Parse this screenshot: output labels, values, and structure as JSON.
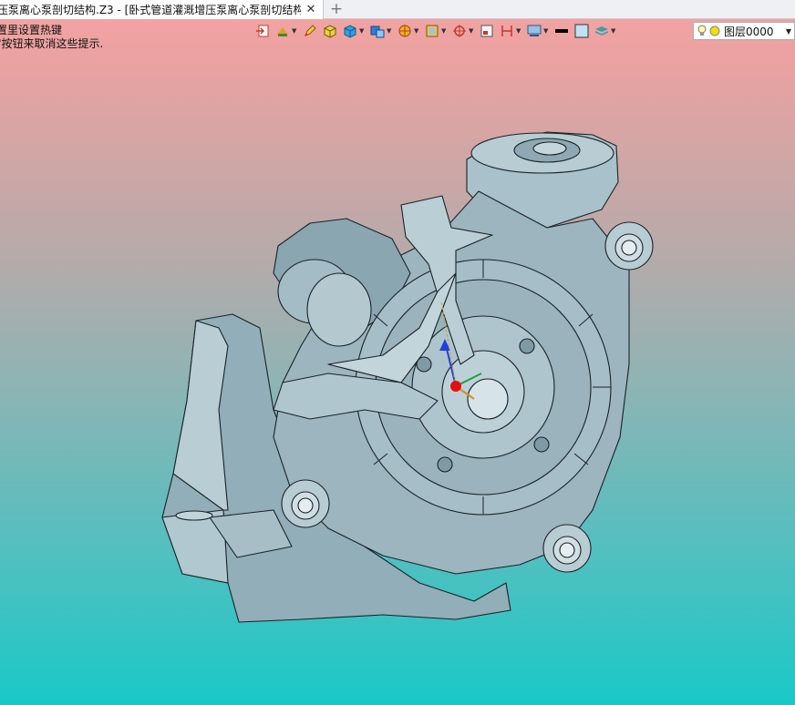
{
  "tabbar": {
    "tab_title": "压泵离心泵剖切结构.Z3 - [卧式管道灌溉增压泵离心泵剖切结构]",
    "close_icon": "close-icon",
    "add_icon": "plus-icon"
  },
  "hint": {
    "line1": "置里设置热键",
    "line2": "\"按钮来取消这些提示."
  },
  "toolbar": {
    "icons": [
      "exit-icon",
      "tree-icon",
      "pen-icon",
      "box-icon",
      "cube-icon",
      "view-cube-icon",
      "render-icon",
      "display-icon",
      "axis-icon",
      "frame-icon",
      "dimension-icon",
      "filter-icon",
      "line-color-icon",
      "fill-color-icon",
      "layer-stack-icon"
    ],
    "colors": {
      "line": "#000000",
      "fill": "#bfe3f2"
    }
  },
  "layer": {
    "label": "图层0000",
    "bulb_icon": "lightbulb-icon",
    "dot_color": "#f0e000"
  },
  "model": {
    "name": "pump-cutaway-model",
    "color": "#9fb9c3"
  }
}
